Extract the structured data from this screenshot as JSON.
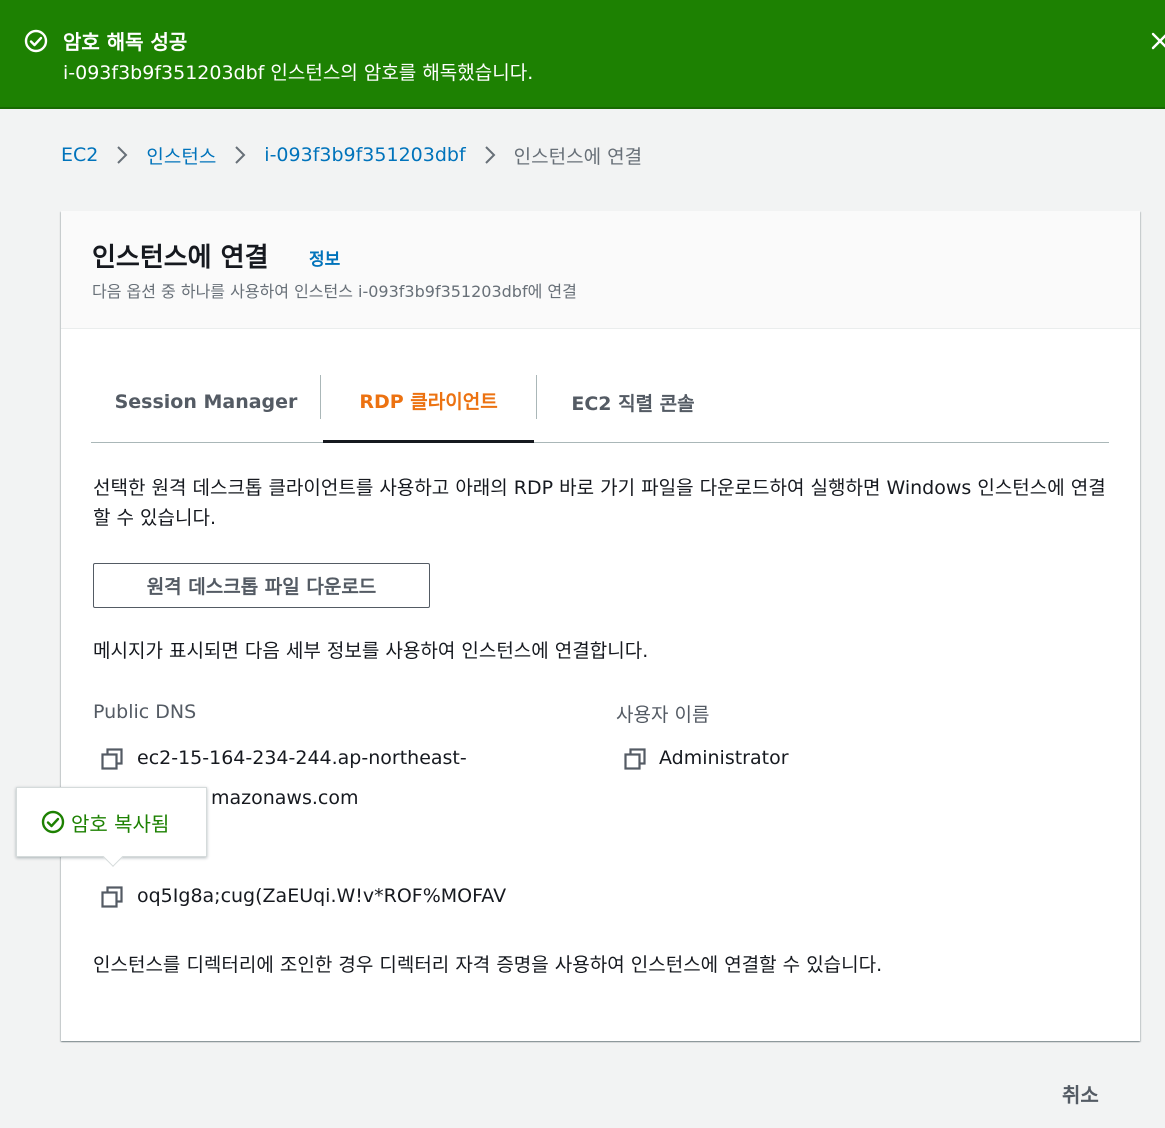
{
  "flash": {
    "title": "암호 해독 성공",
    "message": "i-093f3b9f351203dbf 인스턴스의 암호를 해독했습니다.",
    "icon": "check-circle-icon",
    "close_icon": "close-icon",
    "color": "#1d8102"
  },
  "breadcrumb": {
    "items": [
      "EC2",
      "인스턴스",
      "i-093f3b9f351203dbf"
    ],
    "current": "인스턴스에 연결"
  },
  "panel": {
    "title": "인스턴스에 연결",
    "info_link": "정보",
    "description": "다음 옵션 중 하나를 사용하여 인스턴스 i-093f3b9f351203dbf에 연결"
  },
  "tabs": [
    {
      "label": "Session Manager",
      "active": false
    },
    {
      "label": "RDP 클라이언트",
      "active": true
    },
    {
      "label": "EC2 직렬 콘솔",
      "active": false
    }
  ],
  "rdp": {
    "intro": "선택한 원격 데스크톱 클라이언트를 사용하고 아래의 RDP 바로 가기 파일을 다운로드하여 실행하면 Windows 인스턴스에 연결할 수 있습니다.",
    "download_button": "원격 데스크톱 파일 다운로드",
    "prompt_text": "메시지가 표시되면 다음 세부 정보를 사용하여 인스턴스에 연결합니다.",
    "public_dns_label": "Public DNS",
    "public_dns_line1": "ec2-15-164-234-244.ap-northeast-",
    "public_dns_line2": "mazonaws.com",
    "username_label": "사용자 이름",
    "username": "Administrator",
    "password": "oq5Ig8a;cug(ZaEUqi.W!v*ROF%MOFAV",
    "directory_note": "인스턴스를 디렉터리에 조인한 경우 디렉터리 자격 증명을 사용하여 인스턴스에 연결할 수 있습니다."
  },
  "popover": {
    "text": "암호 복사됨",
    "icon": "check-circle-icon"
  },
  "footer": {
    "cancel": "취소"
  },
  "colors": {
    "link": "#0073bb",
    "active_tab": "#ec7211",
    "success": "#1d8102"
  }
}
